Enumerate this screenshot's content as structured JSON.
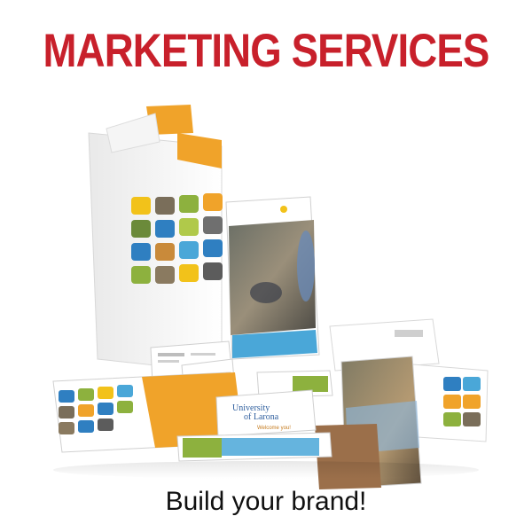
{
  "headline": "MARKETING SERVICES",
  "tagline": "Build your brand!",
  "brand": {
    "name_line1": "University",
    "name_line2": "of Larona",
    "welcome": "Welcome you!"
  },
  "colors": {
    "headline": "#c8202b",
    "orange": "#f0a32a",
    "blue": "#2f7fc1",
    "green": "#8db13e",
    "yellow": "#f2c21a",
    "teal": "#4aa7d8"
  }
}
